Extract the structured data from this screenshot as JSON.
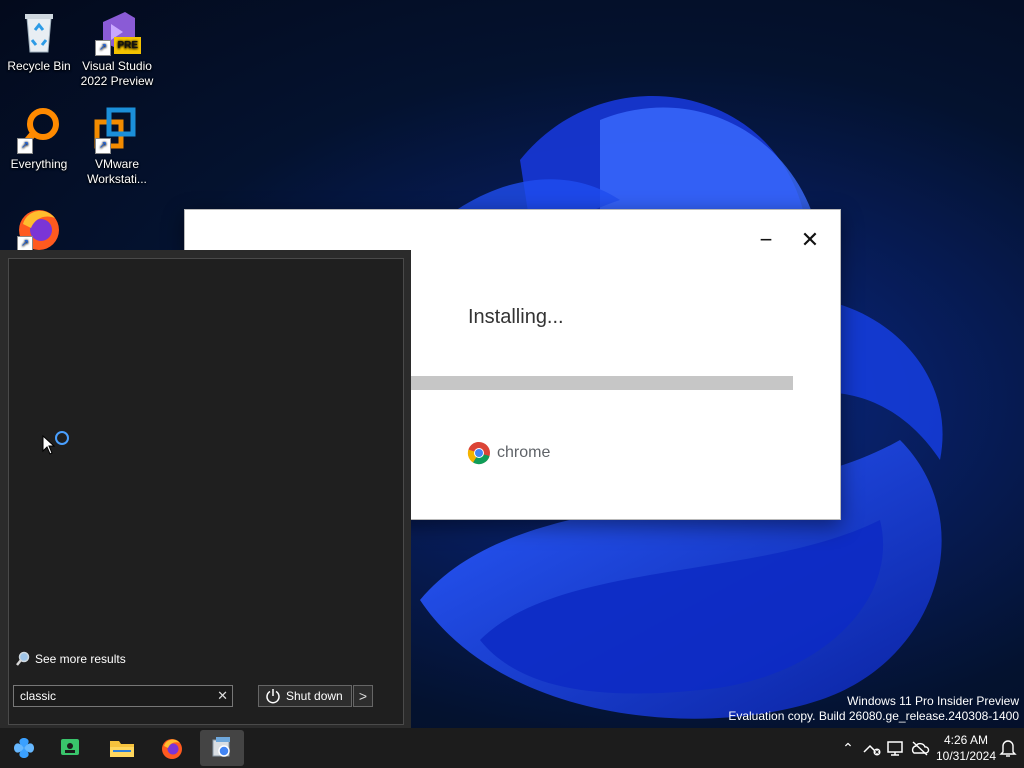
{
  "desktop": {
    "icons": [
      {
        "label": "Recycle Bin",
        "icon": "recycle-bin-icon"
      },
      {
        "label": "Visual Studio 2022 Preview",
        "line1": "Visual Studio",
        "line2": "2022 Preview",
        "badge": "PRE",
        "icon": "visual-studio-icon"
      },
      {
        "label": "Everything",
        "icon": "everything-search-icon"
      },
      {
        "label": "VMware Workstati...",
        "line1": "VMware",
        "line2": "Workstati...",
        "icon": "vmware-icon"
      },
      {
        "label": "",
        "icon": "firefox-icon"
      }
    ]
  },
  "installer": {
    "status_text": "Installing...",
    "brand": "chrome",
    "minimize": "−",
    "close": "✕",
    "progress_fraction": 0.0,
    "colors": {
      "track": "#c6c6c6"
    }
  },
  "start_menu": {
    "see_more": "See more results",
    "search_value": "classic",
    "clear": "✕",
    "shutdown_label": "Shut down",
    "arrow": ">"
  },
  "watermark": {
    "line1": "Windows 11 Pro Insider Preview",
    "line2": "Evaluation copy. Build 26080.ge_release.240308-1400"
  },
  "taskbar": {
    "buttons": [
      "start-icon",
      "chat-icon",
      "file-explorer-icon",
      "firefox-icon",
      "installer-icon"
    ],
    "clock": {
      "time": "4:26 AM",
      "date": "10/31/2024"
    }
  }
}
